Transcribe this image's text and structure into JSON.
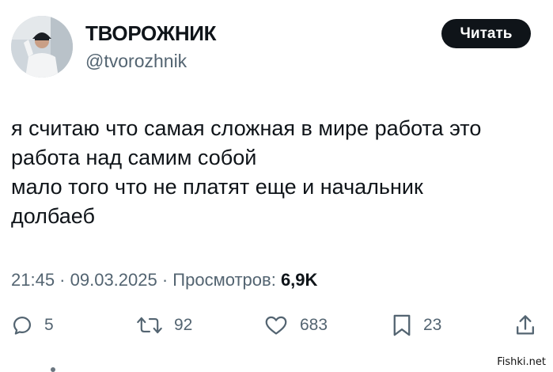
{
  "header": {
    "display_name": "ТВОРОЖНИК",
    "handle": "@tvorozhnik",
    "read_button_label": "Читать",
    "avatar_icon": "profile-photo"
  },
  "tweet": {
    "lines": [
      "я считаю что самая сложная в мире работа это",
      "работа над самим собой",
      "мало того что не платят еще и начальник",
      "долбаеб"
    ]
  },
  "meta": {
    "time": "21:45",
    "separator": " · ",
    "date": "09.03.2025",
    "views_label": "Просмотров:",
    "views_count": "6,9K"
  },
  "actions": {
    "replies": {
      "icon": "reply-icon",
      "count": "5"
    },
    "reposts": {
      "icon": "repost-icon",
      "count": "92"
    },
    "likes": {
      "icon": "like-icon",
      "count": "683"
    },
    "bookmarks": {
      "icon": "bookmark-icon",
      "count": "23"
    },
    "share": {
      "icon": "share-icon"
    }
  },
  "watermark": "Fishki.net",
  "colors": {
    "text_primary": "#0f1419",
    "text_secondary": "#536471",
    "button_bg": "#0f1419",
    "button_text": "#ffffff"
  }
}
